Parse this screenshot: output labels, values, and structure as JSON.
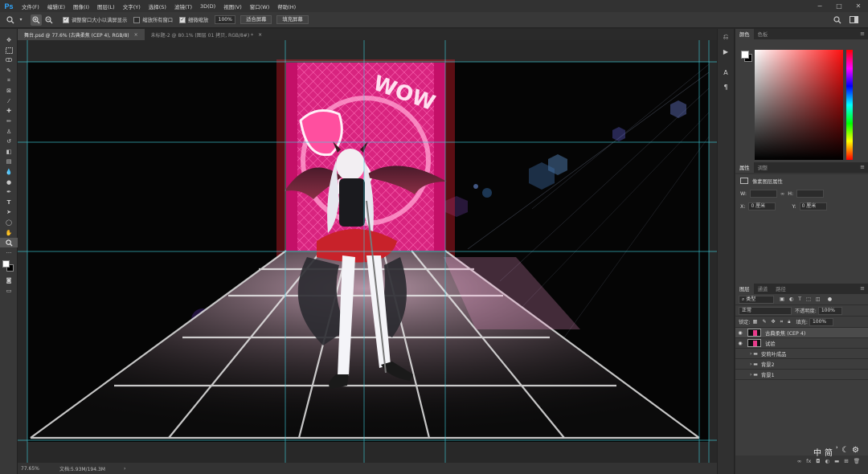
{
  "app": {
    "logo": "Ps"
  },
  "menu": [
    "文件(F)",
    "编辑(E)",
    "图像(I)",
    "图层(L)",
    "文字(Y)",
    "选择(S)",
    "滤镜(T)",
    "3D(D)",
    "视图(V)",
    "窗口(W)",
    "帮助(H)"
  ],
  "window_controls": {
    "minimize": "−",
    "maximize": "□",
    "close": "✕"
  },
  "options": {
    "resize_windows_label": "调整窗口大小以满屏显示",
    "zoom_all_label": "缩放所有窗口",
    "scrubby_zoom_label": "细微缩放",
    "zoom_value": "100%",
    "fit_screen_label": "适合屏幕",
    "fill_screen_label": "填充屏幕"
  },
  "tabs": [
    {
      "label": "舞台.psd @ 77.6% (古典柔焦 (CEP 4), RGB/8)",
      "close": "×"
    },
    {
      "label": "未标题-2 @ 80.1% (图层 01 拷贝, RGB/8#) *",
      "close": "×"
    }
  ],
  "canvas": {
    "sign_text": "WOW"
  },
  "status": {
    "zoom": "77.65%",
    "doc_size": "文档:5.93M/194.3M",
    "arrow": "›"
  },
  "color_panel": {
    "tabs": [
      "颜色",
      "色板"
    ]
  },
  "properties_panel": {
    "tabs": [
      "属性",
      "调整"
    ],
    "heading": "像素图层属性",
    "w_label": "W:",
    "h_label": "H:",
    "x_label": "X:",
    "x_value": "0 厘米",
    "y_label": "Y:",
    "y_value": "0 厘米"
  },
  "layers_panel": {
    "tabs": [
      "图层",
      "通道",
      "路径"
    ],
    "filter_kind": "类型",
    "blend_mode": "正常",
    "opacity_label": "不透明度:",
    "opacity_value": "100%",
    "lock_label": "锁定:",
    "fill_label": "填充:",
    "fill_value": "100%",
    "layers": [
      {
        "name": "古典柔焦 (CEP 4)",
        "visible": true,
        "type": "smart",
        "selected": true
      },
      {
        "name": "试验",
        "visible": true,
        "type": "pixel",
        "selected": false
      },
      {
        "name": "安莉叶成品",
        "visible": false,
        "type": "group",
        "selected": false
      },
      {
        "name": "背景2",
        "visible": false,
        "type": "group",
        "selected": false
      },
      {
        "name": "背景1",
        "visible": false,
        "type": "group",
        "selected": false
      }
    ]
  },
  "ime": {
    "chinese": "中",
    "simplified": "简"
  },
  "icons": {
    "zoom_tool": "magnifier-icon",
    "search": "search-icon",
    "workspace": "workspace-icon"
  },
  "colors": {
    "accent": "#31a8ff",
    "sign_pink": "#e8268a",
    "guide": "#3fd0e0"
  }
}
